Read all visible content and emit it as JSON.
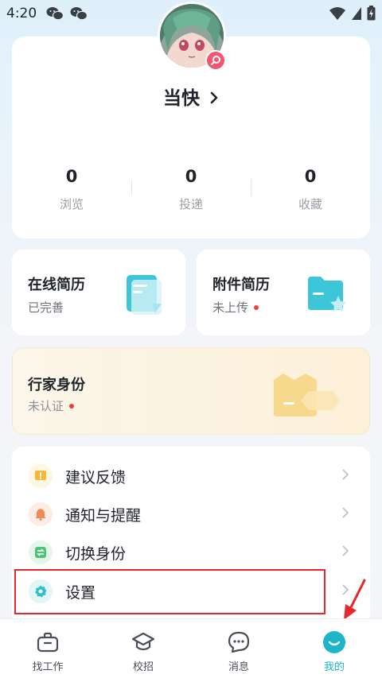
{
  "status_bar": {
    "time": "4:20"
  },
  "profile": {
    "name": "当快"
  },
  "stats": [
    {
      "value": "0",
      "label": "浏览"
    },
    {
      "value": "0",
      "label": "投递"
    },
    {
      "value": "0",
      "label": "收藏"
    }
  ],
  "resume_cards": [
    {
      "title": "在线简历",
      "status": "已完善"
    },
    {
      "title": "附件简历",
      "status": "未上传"
    }
  ],
  "expert_card": {
    "title": "行家身份",
    "status": "未认证"
  },
  "menu": [
    {
      "label": "建议反馈",
      "icon": "feedback-icon"
    },
    {
      "label": "通知与提醒",
      "icon": "bell-icon"
    },
    {
      "label": "切换身份",
      "icon": "switch-identity-icon"
    },
    {
      "label": "设置",
      "icon": "gear-icon"
    }
  ],
  "tabbar": [
    {
      "label": "找工作",
      "icon": "briefcase-icon"
    },
    {
      "label": "校招",
      "icon": "graduation-cap-icon"
    },
    {
      "label": "消息",
      "icon": "chat-bubble-icon"
    },
    {
      "label": "我的",
      "icon": "smile-icon",
      "active": true
    }
  ],
  "colors": {
    "accent": "#1db5c8",
    "badge": "#f25671",
    "alert_dot": "#f03e3e",
    "highlight": "#e8272c"
  }
}
